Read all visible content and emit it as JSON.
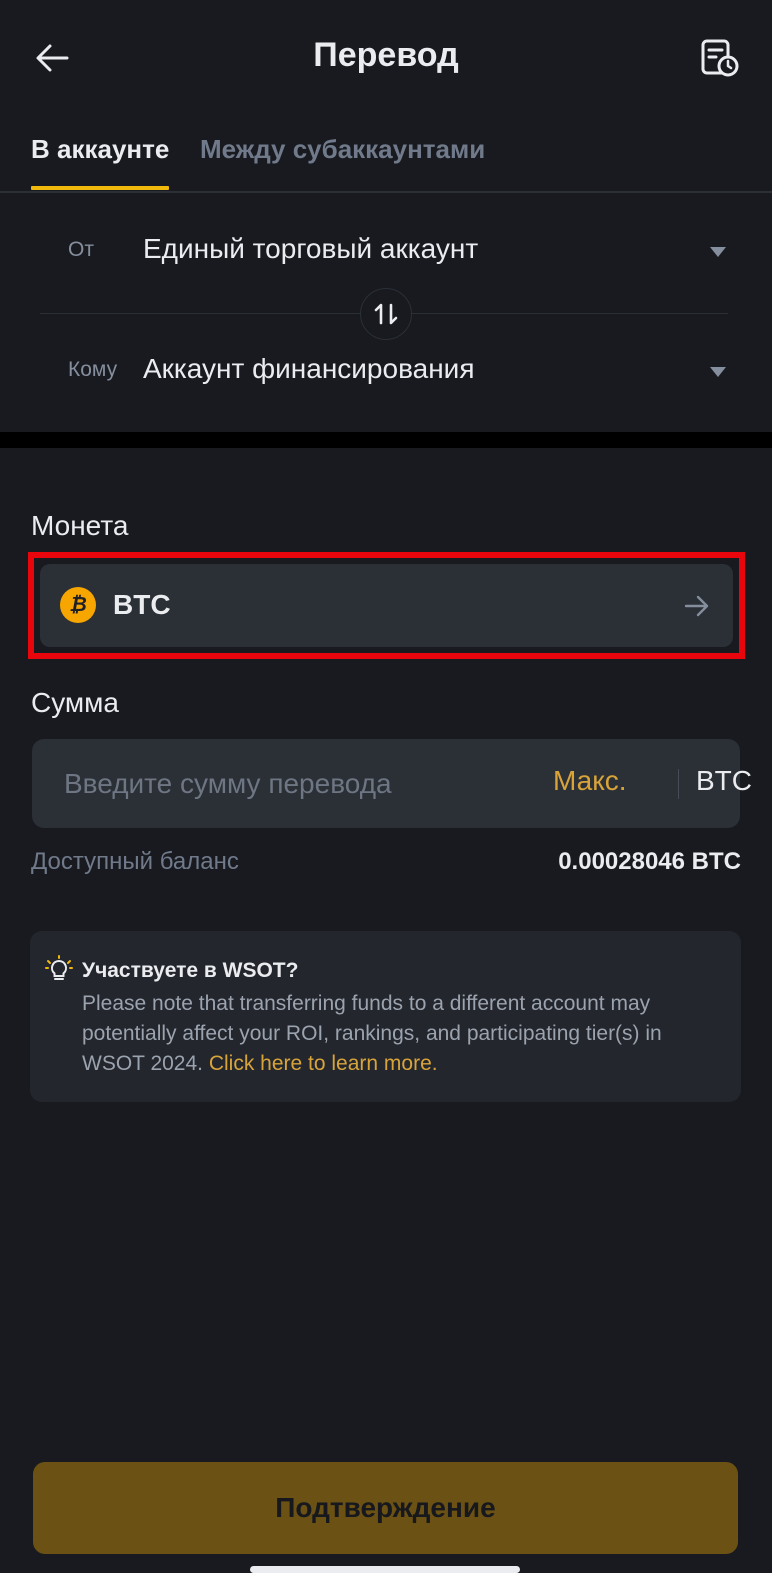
{
  "header": {
    "title": "Перевод",
    "back_icon": "arrow-left-icon",
    "history_icon": "history-doc-clock-icon"
  },
  "tabs": [
    {
      "label": "В аккаунте",
      "active": true
    },
    {
      "label": "Между субаккаунтами",
      "active": false
    }
  ],
  "transfer": {
    "from_label": "От",
    "from_value": "Единый торговый аккаунт",
    "to_label": "Кому",
    "to_value": "Аккаунт финансирования",
    "swap_icon": "swap-arrows-icon"
  },
  "coin": {
    "section_label": "Монета",
    "symbol": "BTC",
    "logo_glyph": "₿"
  },
  "amount": {
    "section_label": "Сумма",
    "placeholder": "Введите сумму перевода",
    "value": "",
    "max_label": "Макс.",
    "unit": "BTC"
  },
  "balance": {
    "label": "Доступный баланс",
    "value": "0.00028046 BTC"
  },
  "notice": {
    "icon": "lightbulb-icon",
    "title": "Участвуете в WSOT?",
    "body": "Please note that transferring funds to a different account may potentially affect your ROI, rankings, and participating tier(s) in WSOT 2024.",
    "link": "Click here to learn more."
  },
  "confirm": {
    "label": "Подтверждение"
  },
  "colors": {
    "background": "#181a20",
    "accent": "#f0b90b",
    "highlight_border": "#e8050c",
    "button_disabled": "#6b5113"
  }
}
